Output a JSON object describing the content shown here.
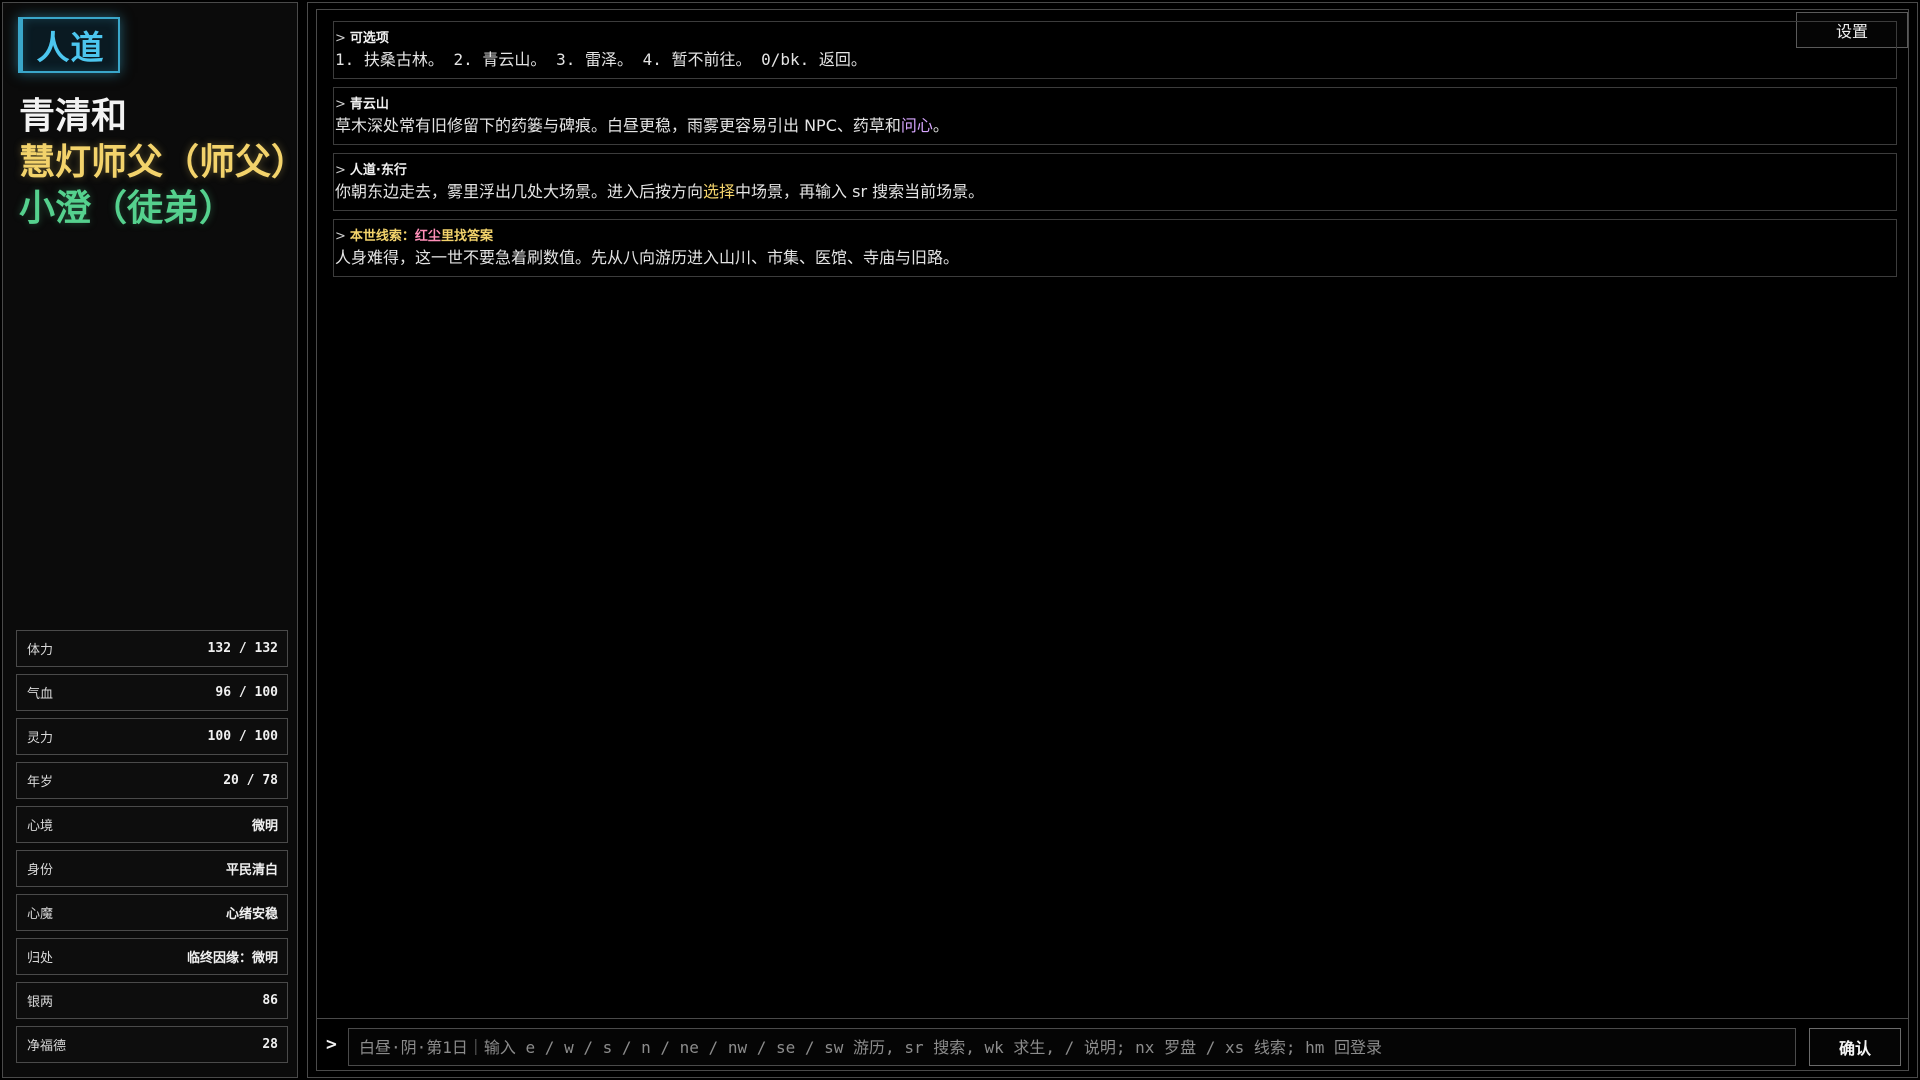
{
  "sidebar": {
    "realm": "人道",
    "characters": [
      {
        "name": "青清和",
        "color": "#f2f2f2"
      },
      {
        "name": "慧灯师父（师父）",
        "color": "#f3d36b"
      },
      {
        "name": "小澄（徒弟）",
        "color": "#55d18e"
      }
    ],
    "stats": [
      {
        "label": "体力",
        "value": "132 / 132"
      },
      {
        "label": "气血",
        "value": "96 / 100"
      },
      {
        "label": "灵力",
        "value": "100 / 100"
      },
      {
        "label": "年岁",
        "value": "20 / 78"
      },
      {
        "label": "心境",
        "value": "微明"
      },
      {
        "label": "身份",
        "value": "平民清白"
      },
      {
        "label": "心魔",
        "value": "心绪安稳"
      },
      {
        "label": "归处",
        "value": "临终因缘：微明"
      },
      {
        "label": "银两",
        "value": "86"
      },
      {
        "label": "净福德",
        "value": "28"
      }
    ]
  },
  "main": {
    "settings_label": "设置",
    "log": [
      {
        "head": [
          {
            "text": "可选项"
          }
        ],
        "body": [
          {
            "text": "1. 扶桑古林。 2. 青云山。 3. 雷泽。 4. 暂不前往。 0/bk. 返回。"
          }
        ],
        "mono": true
      },
      {
        "head": [
          {
            "text": "青云山"
          }
        ],
        "body": [
          {
            "text": "草木深处常有旧修留下的药篓与碑痕。白昼更稳，雨雾更容易引出 NPC、药草和"
          },
          {
            "text": "问心",
            "hl": "purple"
          },
          {
            "text": "。"
          }
        ],
        "mono": false
      },
      {
        "head": [
          {
            "text": "人道·东行"
          }
        ],
        "body": [
          {
            "text": "你朝东边走去，雾里浮出几处大场景。进入后按方向"
          },
          {
            "text": "选择",
            "hl": "yellow"
          },
          {
            "text": "中场景，再输入 sr 搜索当前场景。"
          }
        ],
        "mono": false
      },
      {
        "head": [
          {
            "text": "本世线索：",
            "hl": "yellow"
          },
          {
            "text": "红尘",
            "hl": "pink"
          },
          {
            "text": "里找答案",
            "hl": "yellow"
          }
        ],
        "body": [
          {
            "text": "人身难得，这一世不要急着刷数值。先从八向游历进入山川、市集、医馆、寺庙与旧路。"
          }
        ],
        "mono": false
      }
    ]
  },
  "command": {
    "prompt": ">",
    "placeholder": "白昼·阴·第1日｜输入 e / w / s / n / ne / nw / se / sw 游历, sr 搜索, wk 求生, / 说明; nx 罗盘 / xs 线索; hm 回登录",
    "value": "",
    "confirm_label": "确认"
  }
}
